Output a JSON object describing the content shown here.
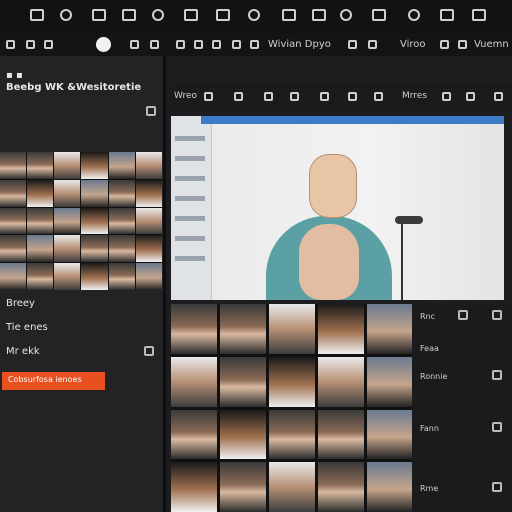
{
  "menu": {
    "items": [
      "Wivian Dpyo",
      "Viroo",
      "Vuemn"
    ]
  },
  "left_panel": {
    "header": "Beebg WK &Wesitoretie",
    "lines": [
      "Breey",
      "Tie enes",
      "Mr ekk"
    ],
    "orange_button": "Cobsurfosa ienoes"
  },
  "content_toolbar": {
    "items": [
      "Wreo",
      "Mrres"
    ]
  },
  "right_strip": {
    "lines": [
      "Rnc",
      "Feaa",
      "Ronnie",
      "Fann",
      "Rme"
    ]
  },
  "colors": {
    "accent": "#e8501f",
    "background": "#1d1d1f",
    "video_header": "#3d7bc8"
  }
}
